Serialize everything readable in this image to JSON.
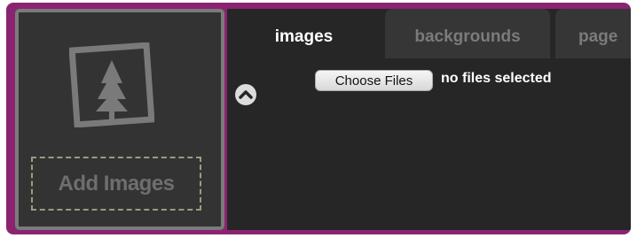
{
  "sidebar": {
    "add_images_label": "Add Images",
    "image_icon": "picture-tree-icon"
  },
  "tabs": [
    {
      "label": "images",
      "active": true
    },
    {
      "label": "backgrounds",
      "active": false
    },
    {
      "label": "page",
      "active": false
    }
  ],
  "upload": {
    "choose_button_label": "Choose Files",
    "status_text": "no files selected",
    "collapse_icon": "chevron-up-icon"
  },
  "colors": {
    "frame_border": "#8a2470",
    "panel_bg": "#333333",
    "main_bg": "#262626",
    "inactive_tab_bg": "#363636"
  }
}
